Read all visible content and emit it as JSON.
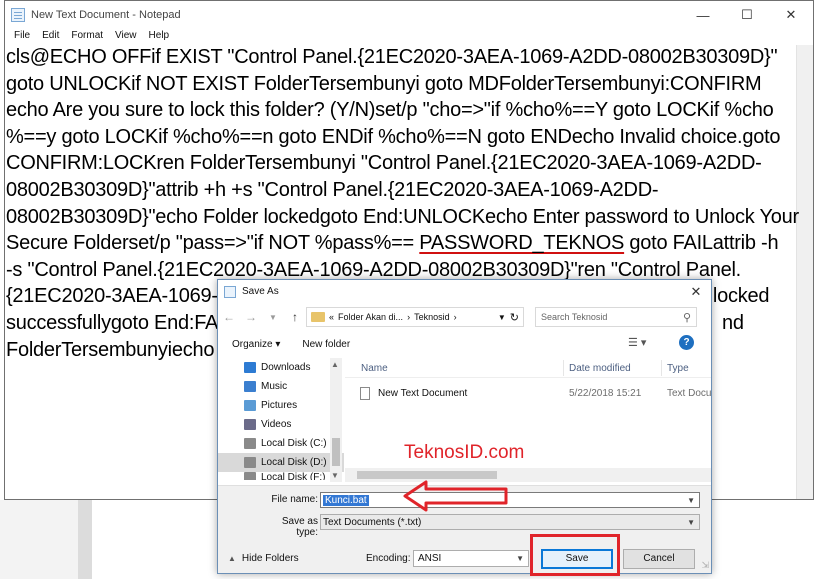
{
  "notepad": {
    "title": "New Text Document - Notepad",
    "menu": [
      "File",
      "Edit",
      "Format",
      "View",
      "Help"
    ],
    "lines": [
      "cls@ECHO OFFif EXIST \"Control Panel.{21EC2020-3AEA-1069-A2DD-08002B30309D}\"",
      "goto UNLOCKif NOT EXIST FolderTersembunyi goto MDFolderTersembunyi:CONFIRM",
      "echo Are you sure to lock this folder? (Y/N)set/p \"cho=>\"if %cho%==Y goto LOCKif %cho",
      "%==y goto LOCKif %cho%==n goto ENDif %cho%==N goto ENDecho Invalid choice.goto",
      "CONFIRM:LOCKren FolderTersembunyi \"Control Panel.{21EC2020-3AEA-1069-A2DD-",
      "08002B30309D}\"attrib +h +s \"Control Panel.{21EC2020-3AEA-1069-A2DD-",
      "08002B30309D}\"echo Folder lockedgoto End:UNLOCKecho Enter password to Unlock Your"
    ],
    "line8_pre": "Secure Folderset/p \"pass=>\"if NOT %pass%== ",
    "line8_pw": "PASSWORD_TEKNOS",
    "line8_post": " goto FAILattrib -h",
    "line9": "-s \"Control Panel.{21EC2020-3AEA-1069-A2DD-08002B30309D}\"ren \"Control Panel.",
    "line10_left": "{21EC2020-3AEA-1069-",
    "line10_right": "nlocked",
    "line11_left": "successfullygoto End:FA",
    "line11_right": "nd",
    "line12_left": "FolderTersembunyiecho"
  },
  "dialog": {
    "title": "Save As",
    "breadcrumb": [
      "«",
      "Folder Akan di...",
      "›",
      "Teknosid",
      "›"
    ],
    "search_placeholder": "Search Teknosid",
    "organize": "Organize ▾",
    "new_folder": "New folder",
    "nav_items": [
      {
        "label": "Downloads",
        "color": "#2d7bd3"
      },
      {
        "label": "Music",
        "color": "#3b7fcf"
      },
      {
        "label": "Pictures",
        "color": "#5a9bd5"
      },
      {
        "label": "Videos",
        "color": "#6b6b8a"
      },
      {
        "label": "Local Disk (C:)",
        "color": "#8a8a8a"
      },
      {
        "label": "Local Disk (D:)",
        "color": "#8a8a8a"
      },
      {
        "label": "Local Disk (F:)",
        "color": "#8a8a8a"
      }
    ],
    "columns": [
      "Name",
      "Date modified",
      "Type"
    ],
    "file": {
      "name": "New Text Document",
      "date": "5/22/2018 15:21",
      "type": "Text Docu"
    },
    "file_name_label": "File name:",
    "file_name_value": "Kunci.bat",
    "save_type_label": "Save as type:",
    "save_type_value": "Text Documents (*.txt)",
    "hide_folders": "Hide Folders",
    "encoding_label": "Encoding:",
    "encoding_value": "ANSI",
    "save": "Save",
    "cancel": "Cancel"
  },
  "watermark": "TeknosID.com",
  "colors": {
    "annotation": "#e0242a",
    "selection": "#3378d4",
    "accent": "#0a78d7"
  }
}
